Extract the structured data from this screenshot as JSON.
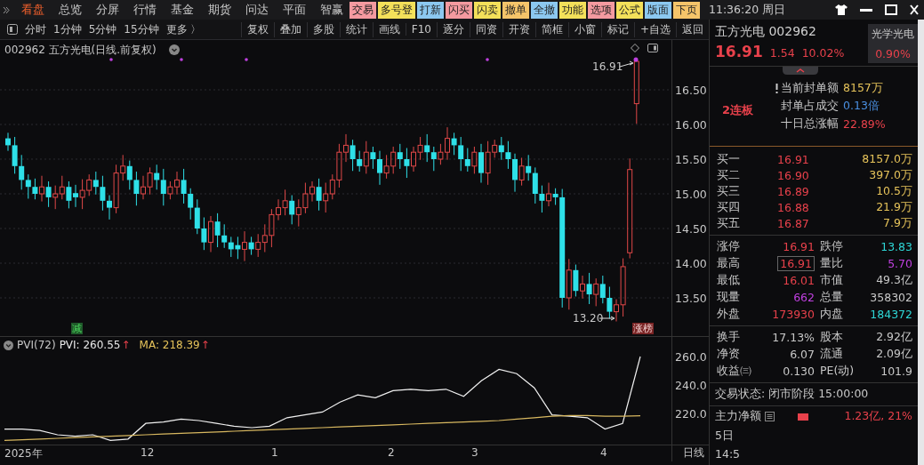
{
  "top_menu": {
    "items": [
      {
        "label": "看盘",
        "selected": true
      },
      {
        "label": "总览",
        "selected": false
      },
      {
        "label": "分屏",
        "selected": false
      },
      {
        "label": "行情",
        "selected": false
      },
      {
        "label": "基金",
        "selected": false
      },
      {
        "label": "期货",
        "selected": false
      },
      {
        "label": "问达",
        "selected": false
      },
      {
        "label": "平面",
        "selected": false
      },
      {
        "label": "智赢",
        "selected": false
      }
    ],
    "buttons": [
      {
        "label": "交易",
        "color": "#f49aa0"
      },
      {
        "label": "多号登",
        "color": "#f3e05a"
      },
      {
        "label": "打新",
        "color": "#8cc8f0"
      },
      {
        "label": "闪买",
        "color": "#f49aa0"
      },
      {
        "label": "闪卖",
        "color": "#f3e05a"
      },
      {
        "label": "撤单",
        "color": "#f5c46a"
      },
      {
        "label": "全撤",
        "color": "#8cc8f0"
      },
      {
        "label": "功能",
        "color": "#f3e05a"
      },
      {
        "label": "选项",
        "color": "#f49aa0"
      },
      {
        "label": "公式",
        "color": "#f3e05a"
      },
      {
        "label": "版面",
        "color": "#8cc8f0"
      },
      {
        "label": "下页",
        "color": "#f5c46a"
      }
    ],
    "clock": "11:36:20 周日"
  },
  "toolbar": {
    "periods": [
      "分时",
      "1分钟",
      "5分钟",
      "15分钟",
      "更多 〉"
    ],
    "tools": [
      "复权",
      "叠加",
      "多股",
      "统计",
      "画线",
      "F10",
      "逐分",
      "同资",
      "开资",
      "简框",
      "小窗",
      "标记",
      "+自选",
      "返回"
    ]
  },
  "main_chart": {
    "title": "002962 五方光电(日线.前复权)",
    "price_axis": [
      "16.50",
      "16.00",
      "15.50",
      "15.00",
      "14.50",
      "14.00",
      "13.50"
    ],
    "high_label": "16.91",
    "low_label": "13.20",
    "badges": [
      {
        "label": "减",
        "color": "#1f5a2a"
      },
      {
        "label": "涨榜",
        "color": "#7a2424"
      }
    ]
  },
  "indicator": {
    "name": "PVI(72)",
    "separator": ": ",
    "readings": [
      {
        "value": "260.55",
        "arrow": "↑",
        "color": "#e8e8e8"
      },
      {
        "value": "218.39",
        "arrow": "↑",
        "color": "#e6c35a"
      }
    ],
    "axis": [
      "260.0",
      "240.0",
      "220.0"
    ],
    "lines": [
      {
        "name": "PVI",
        "color": "#f0f0f0"
      },
      {
        "name": "MA",
        "color": "#d8b860"
      }
    ]
  },
  "date_axis": [
    "2025年",
    "12",
    "1",
    "2",
    "3",
    "4"
  ],
  "period_label": "日线",
  "quote": {
    "name": "五方光电 002962",
    "price": "16.91",
    "change": "1.54",
    "change_pct": "10.02%",
    "sector": {
      "name": "光学光电",
      "change": "0.90%"
    },
    "streak": "2连板",
    "seal": [
      {
        "label": "当前封单额",
        "value": "8157万",
        "color": "#e6c35a"
      },
      {
        "label": "封单占成交",
        "value": "0.13倍",
        "color": "#4a90e2"
      },
      {
        "label": "十日总涨幅",
        "value": "22.89%",
        "color": "#e8414b"
      }
    ],
    "bids": [
      {
        "label": "买一",
        "price": "16.91",
        "volume": "8157.0万"
      },
      {
        "label": "买二",
        "price": "16.90",
        "volume": "397.0万"
      },
      {
        "label": "买三",
        "price": "16.89",
        "volume": "10.5万"
      },
      {
        "label": "买四",
        "price": "16.88",
        "volume": "21.9万"
      },
      {
        "label": "买五",
        "price": "16.87",
        "volume": "7.9万"
      }
    ],
    "stats": [
      {
        "cells": [
          {
            "label": "涨停",
            "value": "16.91",
            "color": "#e8414b",
            "boxed": false
          },
          {
            "label": "跌停",
            "value": "13.83",
            "color": "#2ed6d6",
            "boxed": false
          }
        ]
      },
      {
        "cells": [
          {
            "label": "最高",
            "value": "16.91",
            "color": "#e8414b",
            "boxed": true
          },
          {
            "label": "量比",
            "value": "5.70",
            "color": "#c040e0",
            "boxed": false
          }
        ]
      },
      {
        "cells": [
          {
            "label": "最低",
            "value": "16.01",
            "color": "#e8414b",
            "boxed": false
          },
          {
            "label": "市值",
            "value": "49.3亿",
            "color": "#c8c8c8",
            "boxed": false
          }
        ]
      },
      {
        "cells": [
          {
            "label": "现量",
            "value": "662",
            "color": "#c040e0",
            "boxed": false
          },
          {
            "label": "总量",
            "value": "358302",
            "color": "#c8c8c8",
            "boxed": false
          }
        ]
      },
      {
        "cells": [
          {
            "label": "外盘",
            "value": "173930",
            "color": "#e8414b",
            "boxed": false
          },
          {
            "label": "内盘",
            "value": "184372",
            "color": "#2ed6d6",
            "boxed": false
          }
        ]
      }
    ],
    "fundamentals": [
      {
        "cells": [
          {
            "label": "换手",
            "value": "17.13%"
          },
          {
            "label": "股本",
            "value": "2.92亿"
          }
        ]
      },
      {
        "cells": [
          {
            "label": "净资",
            "value": "6.07"
          },
          {
            "label": "流通",
            "value": "2.09亿"
          }
        ]
      },
      {
        "cells": [
          {
            "label": "收益㈢",
            "value": "0.130"
          },
          {
            "label": "PE(动)",
            "value": "101.9"
          }
        ]
      }
    ],
    "status": "交易状态: 闭市阶段 15:00:00",
    "flow": {
      "label": "主力净额",
      "value": "1.23亿, 21%"
    },
    "more_rows": [
      "5日",
      "14:5"
    ]
  }
}
